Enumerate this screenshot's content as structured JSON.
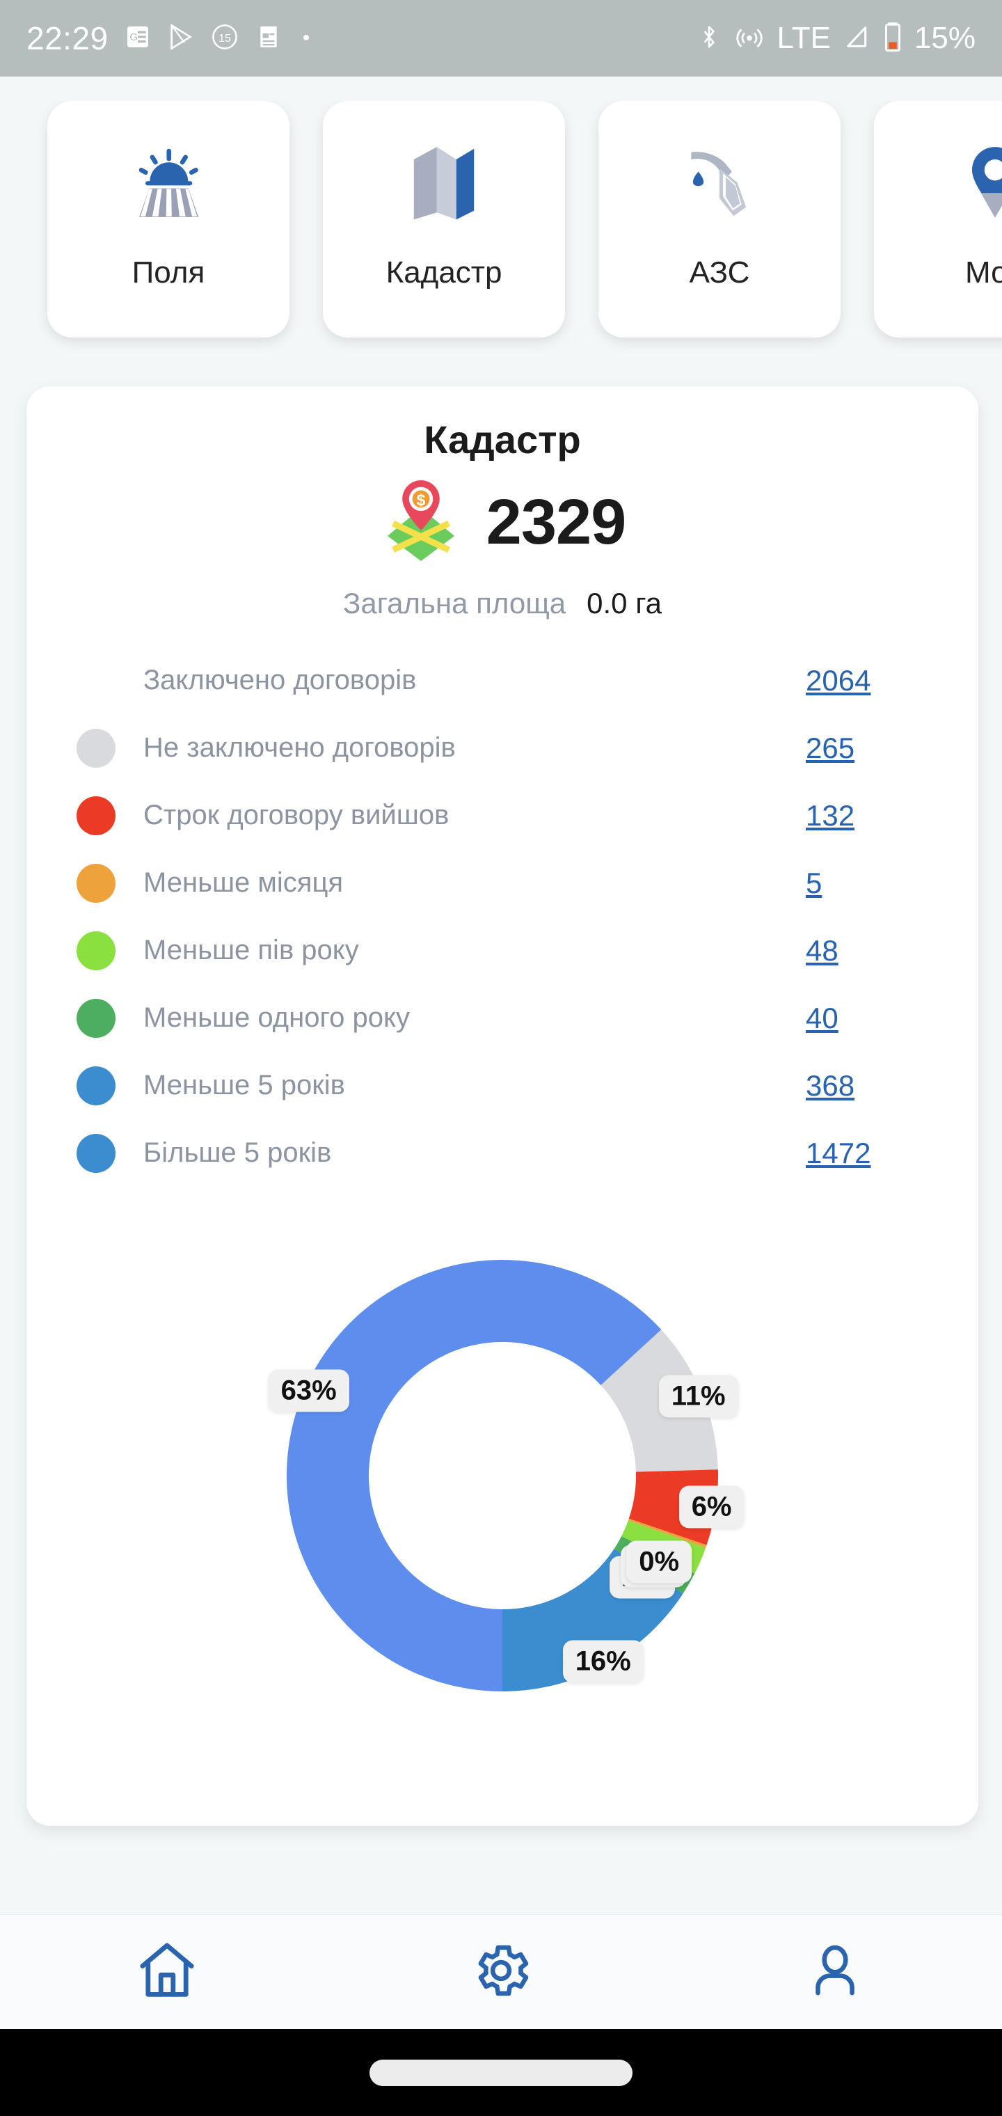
{
  "statusbar": {
    "time": "22:29",
    "battery_percent": "15%",
    "left_icons": [
      "google-news-icon",
      "play-store-icon",
      "timer-15-icon",
      "notes-icon",
      "dot-icon"
    ],
    "right_icons": [
      "bluetooth-icon",
      "nfc-icon",
      "lte-label",
      "signal-icon",
      "battery-icon"
    ],
    "network_label": "LTE",
    "bar_color": "#b5bdbd"
  },
  "quick_cards": [
    {
      "label": "Поля",
      "icon": "field-sunrise-icon"
    },
    {
      "label": "Кадастр",
      "icon": "folded-map-icon"
    },
    {
      "label": "АЗС",
      "icon": "fuel-pump-icon"
    },
    {
      "label": "Мон",
      "icon": "map-pin-monitoring-icon"
    }
  ],
  "main": {
    "title": "Кадастр",
    "total_count": "2329",
    "total_icon": "map-parcel-money-pin-icon",
    "area_label": "Загальна площа",
    "area_value": "0.0 га"
  },
  "legend": [
    {
      "label": "Заключено договорів",
      "value": "2064",
      "color": "none",
      "has_dot": false
    },
    {
      "label": "Не заключено договорів",
      "value": "265",
      "color": "#d9dadd",
      "has_dot": true
    },
    {
      "label": "Строк договору вийшов",
      "value": "132",
      "color": "#eb3b25",
      "has_dot": true
    },
    {
      "label": "Меньше місяця",
      "value": "5",
      "color": "#eda23c",
      "has_dot": true
    },
    {
      "label": "Меньше пів року",
      "value": "48",
      "color": "#89e03f",
      "has_dot": true
    },
    {
      "label": "Меньше одного року",
      "value": "40",
      "color": "#4cae5e",
      "has_dot": true
    },
    {
      "label": "Меньше 5 років",
      "value": "368",
      "color": "#3b8dd0",
      "has_dot": true
    },
    {
      "label": "Більше 5 років",
      "value": "1472",
      "color": "#3b8dd0",
      "has_dot": true
    }
  ],
  "chart_data": {
    "type": "pie",
    "title": "Кадастр",
    "donut": true,
    "start_angle_deg": 180,
    "direction": "clockwise",
    "categories": [
      "Більше 5 років",
      "Не заключено договорів",
      "Строк договору вийшов",
      "Меньше місяця",
      "Меньше пів року",
      "Меньше одного року",
      "Меньше 5 років"
    ],
    "values": [
      1472,
      265,
      132,
      5,
      48,
      40,
      368
    ],
    "percentages": [
      63,
      11,
      6,
      0,
      2,
      2,
      16
    ],
    "labels": [
      "63%",
      "11%",
      "6%",
      "0%",
      "2%",
      "2%",
      "16%"
    ],
    "colors": [
      "#5d8eee",
      "#d9dadd",
      "#eb3b25",
      "#eda23c",
      "#89e03f",
      "#4cae5e",
      "#3b8dd0"
    ],
    "total": 2329,
    "legend_position": "above"
  },
  "bottom_nav": [
    {
      "icon": "home-icon",
      "name": "nav-home"
    },
    {
      "icon": "gear-icon",
      "name": "nav-settings"
    },
    {
      "icon": "person-icon",
      "name": "nav-profile"
    }
  ]
}
